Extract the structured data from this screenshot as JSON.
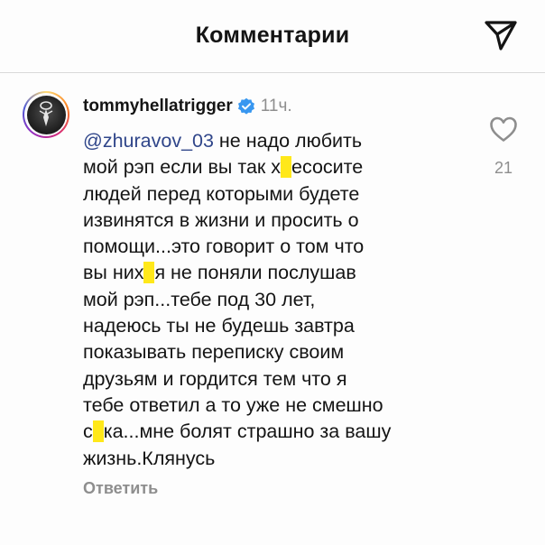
{
  "header": {
    "title": "Комментарии",
    "icons": {
      "share": "send-icon"
    }
  },
  "comment": {
    "username": "tommyhellatrigger",
    "verified": true,
    "time": "11ч.",
    "mention": "@zhuravov_03",
    "lines": [
      " не надо любить",
      "мой рэп если вы так ",
      "х",
      "есосите",
      "людей перед которыми будете",
      "извинятся в жизни и просить о",
      "помощи...это говорит о том что",
      "вы них",
      "я не поняли послушав",
      "мой рэп...тебе под 30 лет,",
      "надеюсь ты не будешь завтра",
      "показывать переписку своим",
      "друзьям и гордится тем что я",
      "тебе ответил а то уже не смешно",
      "с",
      "ка...мне болят страшно за вашу",
      "жизнь.Клянусь"
    ],
    "reply_label": "Ответить",
    "likes": "21"
  },
  "colors": {
    "mention": "#30468a",
    "verified": "#3897f0",
    "highlight": "#ffe81a",
    "secondary_text": "#8e8e8e"
  }
}
